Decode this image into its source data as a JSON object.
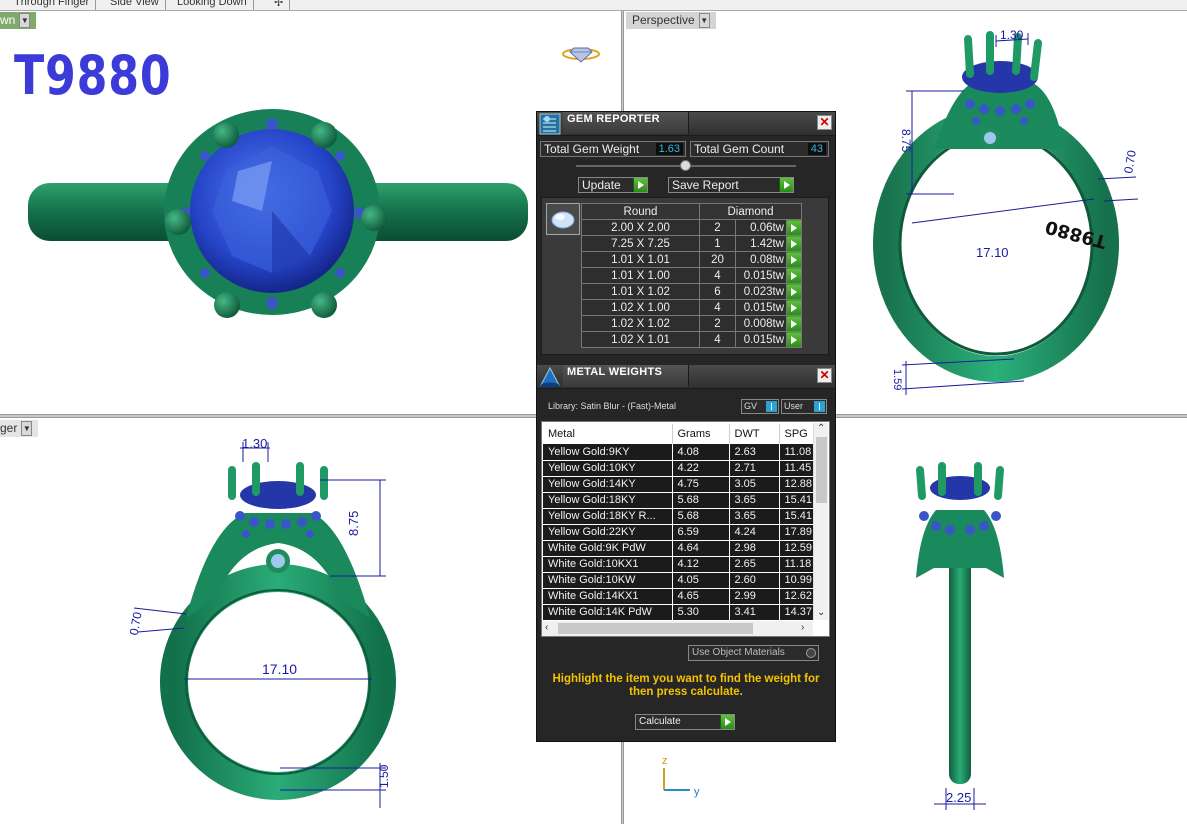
{
  "viewport_tabs": [
    "Through Finger",
    "Side View",
    "Looking Down"
  ],
  "viewports": {
    "top_left_label": "wn",
    "top_right_label": "Perspective",
    "bottom_left_label": "ger"
  },
  "model_code": "T9880",
  "dimensions": {
    "prong_width": "1.30",
    "head_height": "8.75",
    "shank_thickness": "0.70",
    "inner_diameter": "17.10",
    "shank_base": "1.50",
    "perspective_shank_base": "1.59",
    "side_width": "2.25"
  },
  "axes": {
    "z": "z",
    "y": "y"
  },
  "gem_reporter": {
    "title": "GEM REPORTER",
    "total_gem_weight_label": "Total Gem Weight",
    "total_gem_weight": "1.63",
    "total_gem_count_label": "Total Gem Count",
    "total_gem_count": "43",
    "update_label": "Update",
    "save_report_label": "Save Report",
    "shape_header": "Round",
    "material_header": "Diamond",
    "rows": [
      {
        "size": "2.00 X 2.00",
        "qty": "2",
        "weight": "0.06tw"
      },
      {
        "size": "7.25 X 7.25",
        "qty": "1",
        "weight": "1.42tw"
      },
      {
        "size": "1.01 X 1.01",
        "qty": "20",
        "weight": "0.08tw"
      },
      {
        "size": "1.01 X 1.00",
        "qty": "4",
        "weight": "0.015tw"
      },
      {
        "size": "1.01 X 1.02",
        "qty": "6",
        "weight": "0.023tw"
      },
      {
        "size": "1.02 X 1.00",
        "qty": "4",
        "weight": "0.015tw"
      },
      {
        "size": "1.02 X 1.02",
        "qty": "2",
        "weight": "0.008tw"
      },
      {
        "size": "1.02 X 1.01",
        "qty": "4",
        "weight": "0.015tw"
      }
    ]
  },
  "metal_weights": {
    "title": "METAL WEIGHTS",
    "library": "Library: Satin Blur - (Fast)-Metal",
    "gv_label": "GV",
    "user_label": "User",
    "columns": [
      "Metal",
      "Grams",
      "DWT",
      "SPG"
    ],
    "rows": [
      {
        "metal": "Yellow Gold:9KY",
        "grams": "4.08",
        "dwt": "2.63",
        "spg": "11.08"
      },
      {
        "metal": "Yellow Gold:10KY",
        "grams": "4.22",
        "dwt": "2.71",
        "spg": "11.45"
      },
      {
        "metal": "Yellow Gold:14KY",
        "grams": "4.75",
        "dwt": "3.05",
        "spg": "12.88"
      },
      {
        "metal": "Yellow Gold:18KY",
        "grams": "5.68",
        "dwt": "3.65",
        "spg": "15.41"
      },
      {
        "metal": "Yellow Gold:18KY R...",
        "grams": "5.68",
        "dwt": "3.65",
        "spg": "15.41"
      },
      {
        "metal": "Yellow Gold:22KY",
        "grams": "6.59",
        "dwt": "4.24",
        "spg": "17.89"
      },
      {
        "metal": "White Gold:9K PdW",
        "grams": "4.64",
        "dwt": "2.98",
        "spg": "12.59"
      },
      {
        "metal": "White Gold:10KX1",
        "grams": "4.12",
        "dwt": "2.65",
        "spg": "11.18"
      },
      {
        "metal": "White Gold:10KW",
        "grams": "4.05",
        "dwt": "2.60",
        "spg": "10.99"
      },
      {
        "metal": "White Gold:14KX1",
        "grams": "4.65",
        "dwt": "2.99",
        "spg": "12.62"
      },
      {
        "metal": "White Gold:14K PdW",
        "grams": "5.30",
        "dwt": "3.41",
        "spg": "14.37"
      }
    ],
    "use_object_materials_label": "Use Object Materials",
    "hint": "Highlight the item you want to find the weight for then press calculate.",
    "calculate_label": "Calculate"
  },
  "colors": {
    "ring_metal": "#1f8a5a",
    "center_stone": "#2c4fd6",
    "dimension": "#1a1aa0",
    "title_text": "#3b3bd8",
    "panel_bg": "#262626",
    "accent_value": "#39b5e0",
    "hint_text": "#f2c400",
    "go_button": "#3aa428"
  }
}
